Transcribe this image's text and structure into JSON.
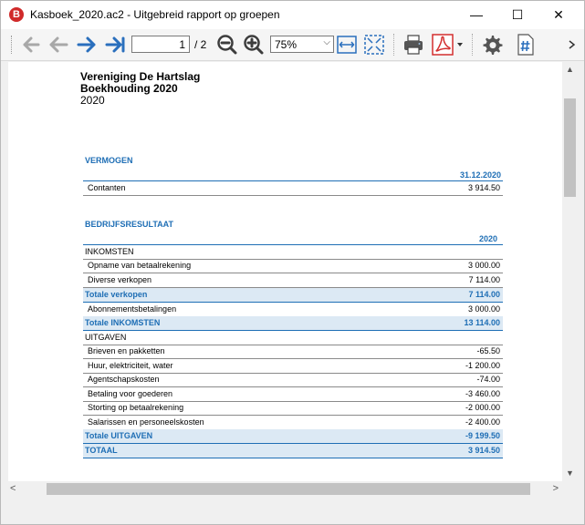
{
  "window": {
    "title": "Kasboek_2020.ac2 - Uitgebreid rapport op groepen",
    "app_icon": "banana-icon",
    "min": "—",
    "max": "☐",
    "close": "✕"
  },
  "toolbar": {
    "page_current": "1",
    "page_total": "/ 2",
    "zoom": "75%",
    "zoom_arrow": "⌵",
    "icons": [
      "first-page-icon",
      "previous-page-icon",
      "next-page-icon",
      "last-page-icon",
      "zoom-out-icon",
      "zoom-in-icon",
      "fit-width-icon",
      "fit-page-icon",
      "print-icon",
      "pdf-icon",
      "settings-icon",
      "page-numbering-icon"
    ]
  },
  "colors": {
    "accent": "#1e6eb5",
    "total_bg": "#dce9f4"
  },
  "report": {
    "org": "Vereniging De Hartslag",
    "subtitle": "Boekhouding 2020",
    "year": "2020",
    "vermogen": {
      "title": "VERMOGEN",
      "col": "31.12.2020",
      "rows": [
        {
          "label": "Contanten",
          "amount": "3 914.50"
        }
      ]
    },
    "resultaat": {
      "title": "BEDRIJFSRESULTAAT",
      "col": "2020",
      "inkomsten_title": "INKOMSTEN",
      "r1": {
        "label": "Opname van betaalrekening",
        "amount": "3 000.00"
      },
      "r2": {
        "label": "Diverse verkopen",
        "amount": "7 114.00"
      },
      "t_verkopen": {
        "label": "Totale verkopen",
        "amount": "7 114.00"
      },
      "r3": {
        "label": "Abonnementsbetalingen",
        "amount": "3 000.00"
      },
      "t_inkomsten": {
        "label": "Totale INKOMSTEN",
        "amount": "13 114.00"
      },
      "uitgaven_title": "UITGAVEN",
      "u1": {
        "label": "Brieven en pakketten",
        "amount": "-65.50"
      },
      "u2": {
        "label": "Huur, elektriciteit, water",
        "amount": "-1 200.00"
      },
      "u3": {
        "label": "Agentschapskosten",
        "amount": "-74.00"
      },
      "u4": {
        "label": "Betaling voor goederen",
        "amount": "-3 460.00"
      },
      "u5": {
        "label": "Storting op betaalrekening",
        "amount": "-2 000.00"
      },
      "u6": {
        "label": "Salarissen en personeelskosten",
        "amount": "-2 400.00"
      },
      "t_uitgaven": {
        "label": "Totale UITGAVEN",
        "amount": "-9 199.50"
      },
      "totaal": {
        "label": "TOTAAL",
        "amount": "3 914.50"
      }
    }
  },
  "scroll": {
    "left": "<",
    "right": ">",
    "up": "▲",
    "down": "▼"
  }
}
